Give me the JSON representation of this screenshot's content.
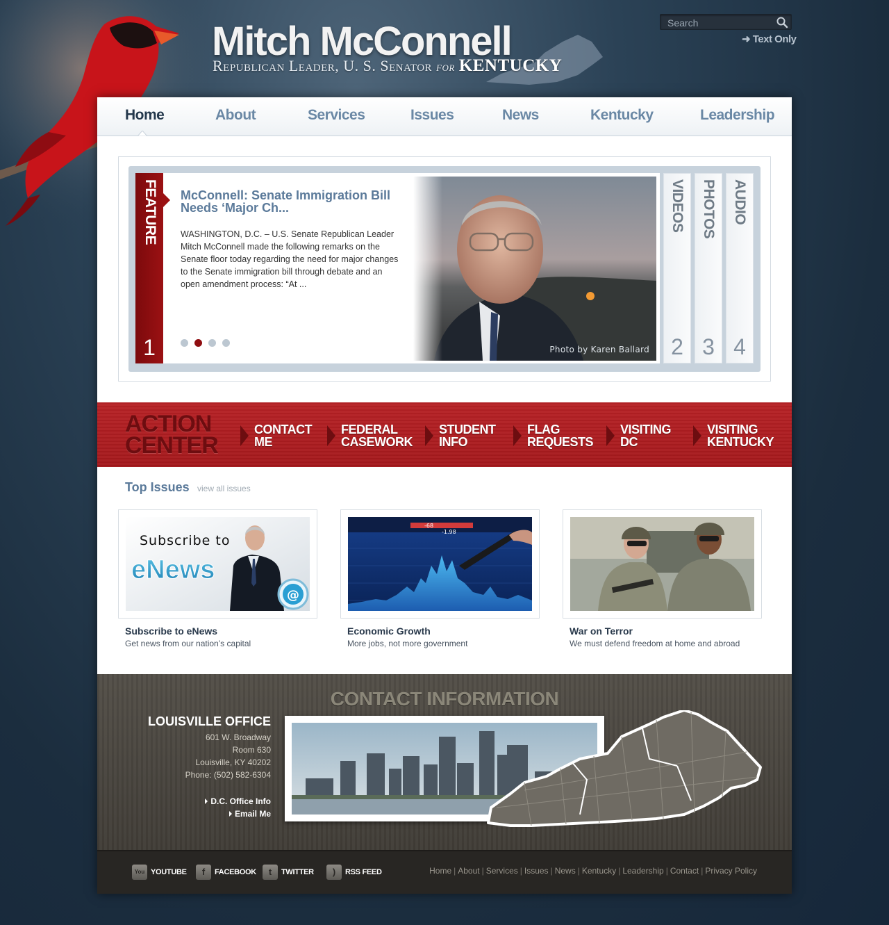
{
  "header": {
    "title": "Mitch McConnell",
    "subtitle_prefix": "Republican Leader, U. S. Senator",
    "subtitle_for": "for",
    "subtitle_state": "KENTUCKY",
    "search_placeholder": "Search",
    "text_only": "Text Only"
  },
  "nav": {
    "items": [
      {
        "label": "Home",
        "active": true
      },
      {
        "label": "About"
      },
      {
        "label": "Services"
      },
      {
        "label": "Issues"
      },
      {
        "label": "News"
      },
      {
        "label": "Kentucky"
      },
      {
        "label": "Leadership"
      }
    ]
  },
  "feature": {
    "ribbon_label": "FEATURE",
    "ribbon_number": "1",
    "title": "McConnell: Senate Immigration Bill Needs ‘Major Ch...",
    "body": "WASHINGTON, D.C. – U.S. Senate Republican Leader Mitch McConnell made the following remarks on the Senate floor today regarding the need for major changes to the Senate immigration bill through debate and an open amendment process: “At ...",
    "photo_credit": "Photo by Karen Ballard",
    "slide_count": 4,
    "active_slide": 2,
    "tabs": [
      {
        "label": "VIDEOS",
        "number": "2"
      },
      {
        "label": "PHOTOS",
        "number": "3"
      },
      {
        "label": "AUDIO",
        "number": "4"
      }
    ]
  },
  "action_center": {
    "title_line1": "ACTION",
    "title_line2": "CENTER",
    "links": [
      {
        "line1": "CONTACT",
        "line2": "ME"
      },
      {
        "line1": "FEDERAL",
        "line2": "CASEWORK"
      },
      {
        "line1": "STUDENT",
        "line2": "INFO"
      },
      {
        "line1": "FLAG",
        "line2": "REQUESTS"
      },
      {
        "line1": "VISITING",
        "line2": "DC"
      },
      {
        "line1": "VISITING",
        "line2": "KENTUCKY"
      }
    ]
  },
  "top_issues": {
    "heading": "Top Issues",
    "view_all": "view all issues",
    "cards": [
      {
        "title": "Subscribe to eNews",
        "desc": "Get news from our nation’s capital",
        "img_line1": "Subscribe to",
        "img_line2": "eNews",
        "img_symbol": "@"
      },
      {
        "title": "Economic Growth",
        "desc": "More jobs, not more government",
        "img_tick1": "-68",
        "img_tick2": "-1.98"
      },
      {
        "title": "War on Terror",
        "desc": "We must defend freedom at home and abroad"
      }
    ]
  },
  "contact": {
    "heading": "CONTACT INFORMATION",
    "office_name": "LOUISVILLE OFFICE",
    "address1": "601 W. Broadway",
    "address2": "Room 630",
    "city": "Louisville, KY 40202",
    "phone": "Phone: (502) 582-6304",
    "dc_link": "D.C. Office Info",
    "email_link": "Email Me"
  },
  "footer": {
    "social": [
      {
        "label": "YOUTUBE",
        "glyph": "You"
      },
      {
        "label": "FACEBOOK",
        "glyph": "f"
      },
      {
        "label": "TWITTER",
        "glyph": "t"
      },
      {
        "label": "RSS FEED",
        "glyph": ")"
      }
    ],
    "links": [
      "Home",
      "About",
      "Services",
      "Issues",
      "News",
      "Kentucky",
      "Leadership",
      "Contact",
      "Privacy Policy"
    ]
  },
  "colors": {
    "accent_red": "#9b1113",
    "nav_blue": "#6a88a5",
    "nav_active": "#24384c"
  }
}
